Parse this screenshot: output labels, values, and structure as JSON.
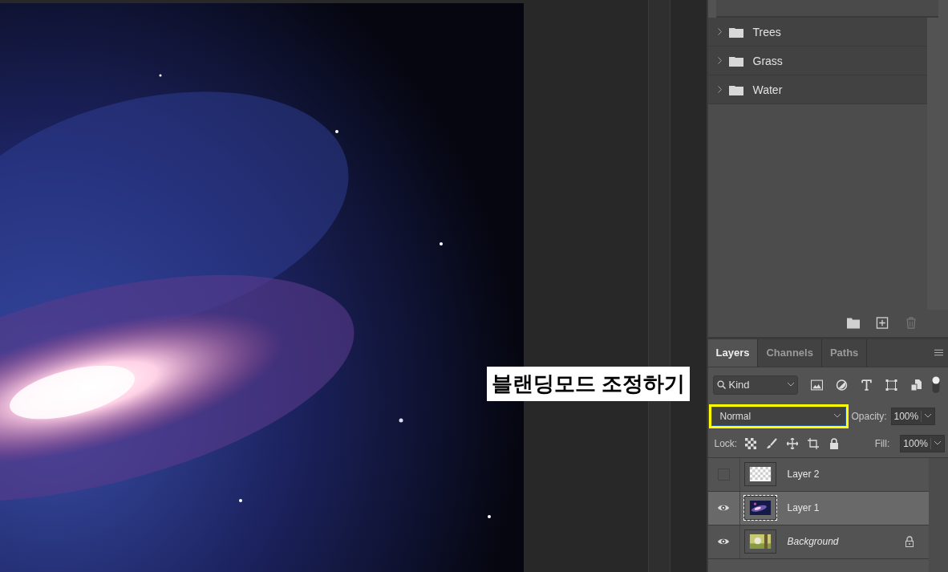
{
  "groups": [
    {
      "name": "Trees",
      "expanded": false
    },
    {
      "name": "Grass",
      "expanded": false
    },
    {
      "name": "Water",
      "expanded": false
    }
  ],
  "tabs": [
    {
      "label": "Layers",
      "selected": true
    },
    {
      "label": "Channels",
      "selected": false
    },
    {
      "label": "Paths",
      "selected": false
    }
  ],
  "filter": {
    "value": "Kind",
    "on": true
  },
  "blend_mode": {
    "value": "Normal"
  },
  "opacity": {
    "label": "Opacity:",
    "value": "100%"
  },
  "lock": {
    "label": "Lock:"
  },
  "fill": {
    "label": "Fill:",
    "value": "100%"
  },
  "layers": [
    {
      "name": "Layer 2",
      "visible": false,
      "selected": false,
      "locked": false,
      "kind": "transparent"
    },
    {
      "name": "Layer 1",
      "visible": true,
      "selected": true,
      "locked": false,
      "kind": "galaxy"
    },
    {
      "name": "Background",
      "visible": true,
      "selected": false,
      "locked": true
    }
  ],
  "annotation": "블랜딩모드 조정하기"
}
